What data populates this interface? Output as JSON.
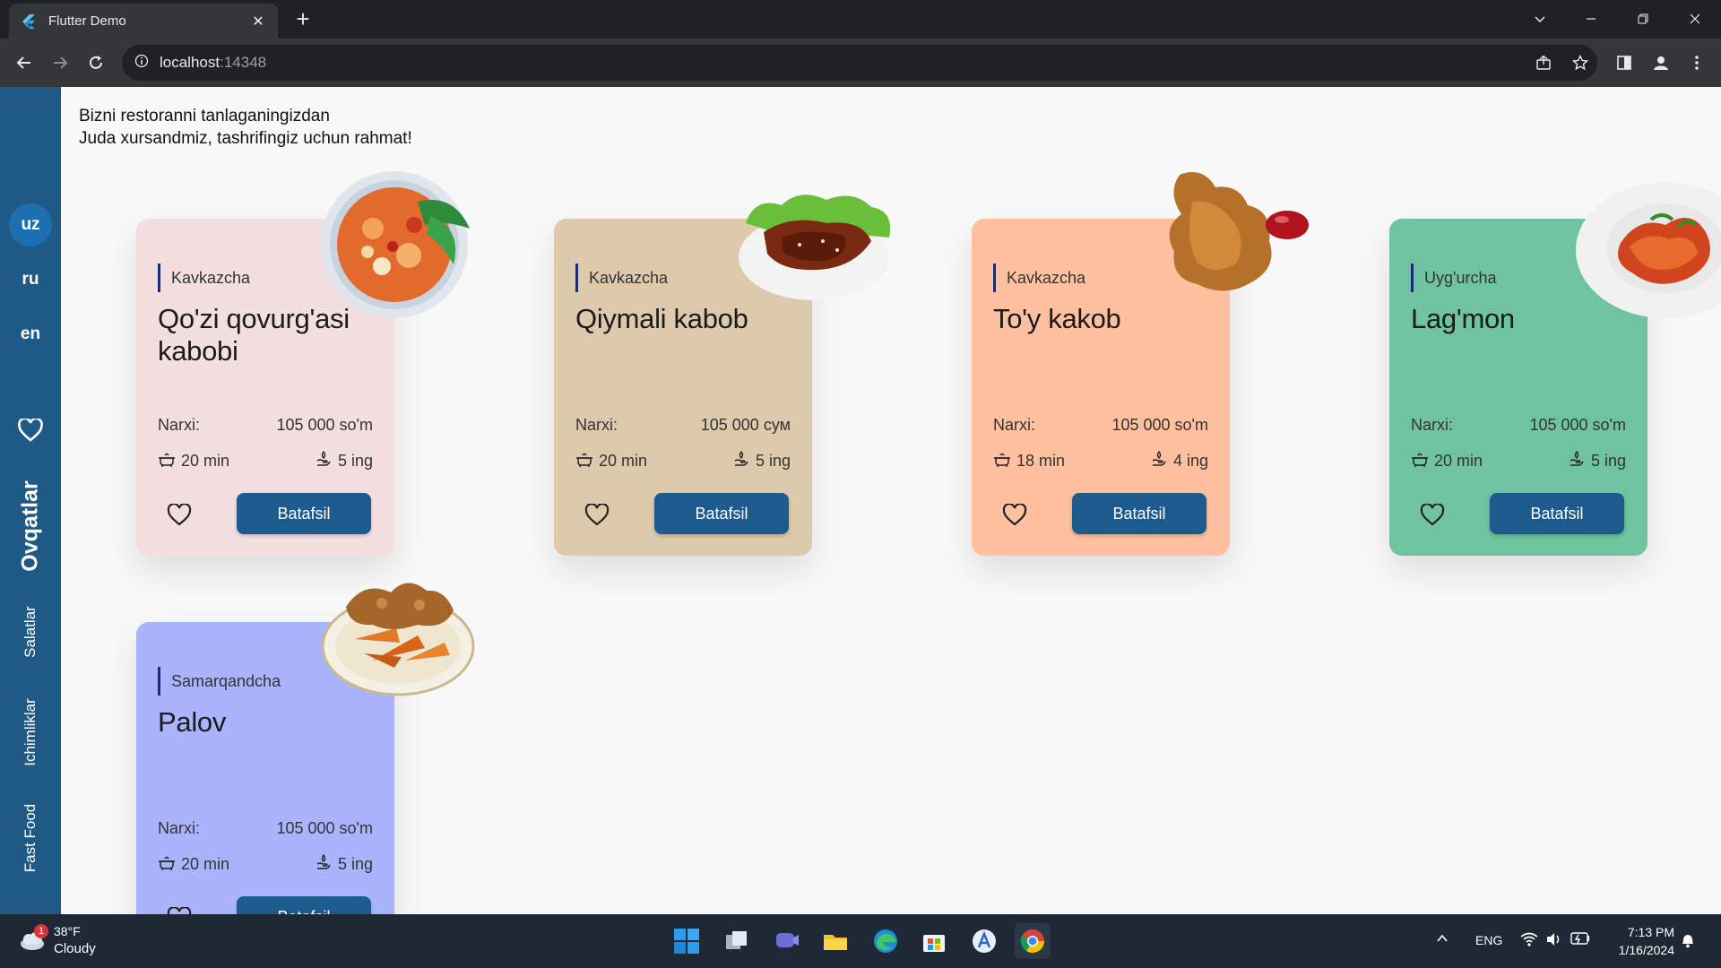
{
  "browser": {
    "tab_title": "Flutter Demo",
    "url_host": "localhost",
    "url_port": ":14348"
  },
  "app": {
    "languages": [
      {
        "code": "uz",
        "active": true
      },
      {
        "code": "ru",
        "active": false
      },
      {
        "code": "en",
        "active": false
      }
    ],
    "categories": [
      {
        "label": "Ovqatlar",
        "active": true
      },
      {
        "label": "Salatlar",
        "active": false
      },
      {
        "label": "Ichimliklar",
        "active": false
      },
      {
        "label": "Fast Food",
        "active": false
      }
    ],
    "greeting_line1": "Bizni restoranni tanlaganingizdan",
    "greeting_line2": "Juda xursandmiz, tashrifingiz uchun rahmat!",
    "price_label": "Narxi:",
    "details_label": "Batafsil",
    "cards": [
      {
        "tag": "Kavkazcha",
        "name": "Qo'zi qovurg'asi kabobi",
        "price": "105 000 so'm",
        "time": "20 min",
        "ing": "5 ing",
        "color": "#f3dfdf",
        "dish": "soup-bowl-icon"
      },
      {
        "tag": "Kavkazcha",
        "name": "Qiymali kabob",
        "price": "105 000 сум",
        "time": "20 min",
        "ing": "5 ing",
        "color": "#ddc9ab",
        "dish": "kebab-plate-icon"
      },
      {
        "tag": "Kavkazcha",
        "name": "To'y kakob",
        "price": "105 000 so'm",
        "time": "18 min",
        "ing": "4 ing",
        "color": "#ffc0a0",
        "dish": "fried-chicken-icon"
      },
      {
        "tag": "Uyg'urcha",
        "name": "Lag'mon",
        "price": "105 000 so'm",
        "time": "20 min",
        "ing": "5 ing",
        "color": "#6fc3a0",
        "dish": "noodle-plate-icon"
      },
      {
        "tag": "Samarqandcha",
        "name": "Palov",
        "price": "105 000 so'm",
        "time": "20 min",
        "ing": "5 ing",
        "color": "#a9b4fd",
        "dish": "potato-wedges-plate-icon"
      }
    ]
  },
  "taskbar": {
    "weather_badge": "1",
    "temperature": "38°F",
    "condition": "Cloudy",
    "lang": "ENG",
    "time": "7:13 PM",
    "date": "1/16/2024"
  },
  "colors": {
    "sidebar": "#1e5a85",
    "button": "#1d5b8e",
    "page_bg": "#f8f8f8"
  }
}
